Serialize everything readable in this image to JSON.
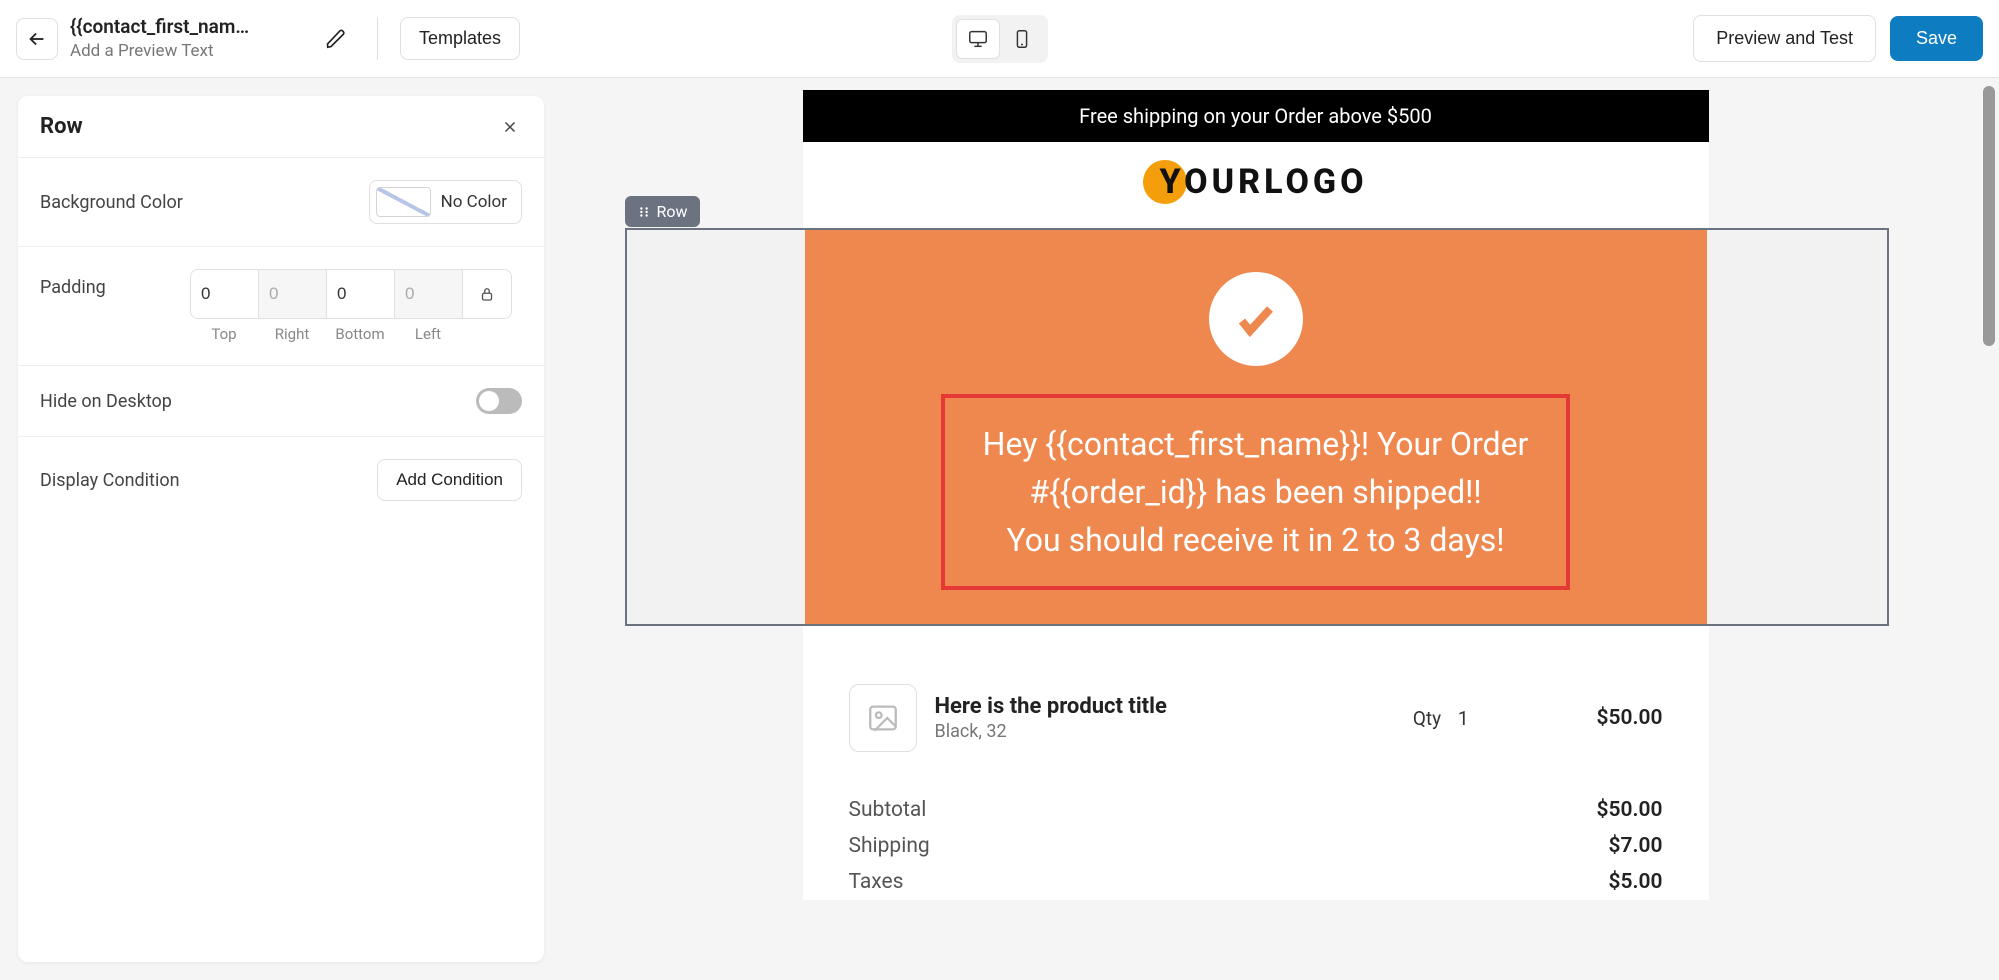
{
  "header": {
    "title": "{{contact_first_nam…",
    "subtitle": "Add a Preview Text",
    "templates_btn": "Templates",
    "preview_btn": "Preview and Test",
    "save_btn": "Save"
  },
  "sidebar": {
    "title": "Row",
    "bg_color_label": "Background Color",
    "bg_color_value": "No Color",
    "padding_label": "Padding",
    "padding": {
      "top": "0",
      "right": "0",
      "bottom": "0",
      "left": "0"
    },
    "padding_hints": {
      "top": "Top",
      "right": "Right",
      "bottom": "Bottom",
      "left": "Left"
    },
    "hide_desktop_label": "Hide on Desktop",
    "display_condition_label": "Display Condition",
    "add_condition_btn": "Add Condition"
  },
  "canvas": {
    "row_tag": "Row",
    "banner": "Free shipping on your Order above $500",
    "logo_text": "YOURLOGO",
    "hero_line1": "Hey {{contact_first_name}}! Your Order",
    "hero_line2": "#{{order_id}} has been shipped!!",
    "hero_line3": "You should receive it in 2 to 3 days!",
    "product": {
      "title": "Here is the product title",
      "variant": "Black, 32",
      "qty_label": "Qty",
      "qty_value": "1",
      "price": "$50.00"
    },
    "totals": {
      "subtotal_label": "Subtotal",
      "subtotal_value": "$50.00",
      "shipping_label": "Shipping",
      "shipping_value": "$7.00",
      "taxes_label": "Taxes",
      "taxes_value": "$5.00"
    }
  }
}
